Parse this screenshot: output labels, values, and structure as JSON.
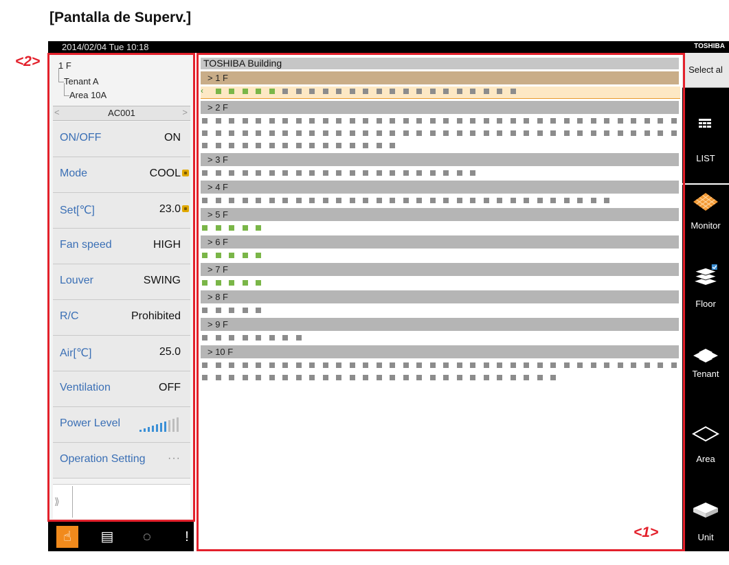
{
  "page_heading": "[Pantalla de Superv.]",
  "topbar": {
    "datetime": "2014/02/04  Tue  10:18",
    "brand": "TOSHIBA"
  },
  "annotations": {
    "left_panel": "<2>",
    "main_area": "<1>"
  },
  "left_panel": {
    "tree": {
      "floor": "1 F",
      "tenant": "Tenant A",
      "area": "Area 10A"
    },
    "unit_nav": {
      "prev": "<",
      "label": "AC001",
      "next": ">"
    },
    "rows": [
      {
        "label": "ON/OFF",
        "value": "ON",
        "locked": false
      },
      {
        "label": "Mode",
        "value": "COOL",
        "locked": true
      },
      {
        "label": "Set[℃]",
        "value": "23.0",
        "locked": true
      },
      {
        "label": "Fan speed",
        "value": "HIGH",
        "locked": false
      },
      {
        "label": "Louver",
        "value": "SWING",
        "locked": false
      },
      {
        "label": "R/C",
        "value": "Prohibited",
        "locked": false
      },
      {
        "label": "Air[℃]",
        "value": "25.0",
        "locked": false
      },
      {
        "label": "Ventilation",
        "value": "OFF",
        "locked": false
      }
    ],
    "power_level": {
      "label": "Power Level",
      "bars": 10,
      "level": 0.7
    },
    "operation_setting": {
      "label": "Operation Setting",
      "dots": "···"
    },
    "footer_chevron": "⟫"
  },
  "bottom_toolbar": [
    {
      "icon": "hand-pointer-icon",
      "glyph": "☝",
      "active": true
    },
    {
      "icon": "document-list-icon",
      "glyph": "▤",
      "active": false
    },
    {
      "icon": "dotted-circle-icon",
      "glyph": "◌",
      "active": false
    },
    {
      "icon": "alert-icon",
      "glyph": "!",
      "active": false
    }
  ],
  "main": {
    "building": "TOSHIBA Building",
    "floors": [
      {
        "label": "> 1 F",
        "selected": true,
        "rows": [
          {
            "green": 5,
            "grey": 18
          }
        ]
      },
      {
        "label": "> 2 F",
        "selected": false,
        "rows": [
          {
            "green": 0,
            "grey": 36
          },
          {
            "green": 0,
            "grey": 36
          },
          {
            "green": 0,
            "grey": 15
          }
        ]
      },
      {
        "label": "> 3 F",
        "selected": false,
        "rows": [
          {
            "green": 0,
            "grey": 21
          }
        ]
      },
      {
        "label": "> 4 F",
        "selected": false,
        "rows": [
          {
            "green": 0,
            "grey": 31
          }
        ]
      },
      {
        "label": "> 5 F",
        "selected": false,
        "rows": [
          {
            "green": 5,
            "grey": 0
          }
        ]
      },
      {
        "label": "> 6 F",
        "selected": false,
        "rows": [
          {
            "green": 5,
            "grey": 0
          }
        ]
      },
      {
        "label": "> 7 F",
        "selected": false,
        "rows": [
          {
            "green": 5,
            "grey": 0
          }
        ]
      },
      {
        "label": "> 8 F",
        "selected": false,
        "rows": [
          {
            "green": 0,
            "grey": 5
          }
        ]
      },
      {
        "label": "> 9 F",
        "selected": false,
        "rows": [
          {
            "green": 0,
            "grey": 8
          }
        ]
      },
      {
        "label": "> 10 F",
        "selected": false,
        "rows": [
          {
            "green": 0,
            "grey": 36
          },
          {
            "green": 0,
            "grey": 27
          }
        ]
      }
    ]
  },
  "right_sidebar": {
    "select_all": "Select al",
    "list": "LIST",
    "nav": [
      {
        "label": "Monitor",
        "icon": "monitor-grid-icon"
      },
      {
        "label": "Floor",
        "icon": "floor-layers-icon"
      },
      {
        "label": "Tenant",
        "icon": "tenant-icon"
      },
      {
        "label": "Area",
        "icon": "area-diamond-icon"
      },
      {
        "label": "Unit",
        "icon": "unit-icon"
      }
    ]
  },
  "colors": {
    "accent_red": "#e3202b",
    "running_green": "#7ab648",
    "stopped_grey": "#8c8c8c",
    "selected_floor": "#c9ad88",
    "label_blue": "#3a6fb5",
    "active_orange": "#f18a1c"
  }
}
